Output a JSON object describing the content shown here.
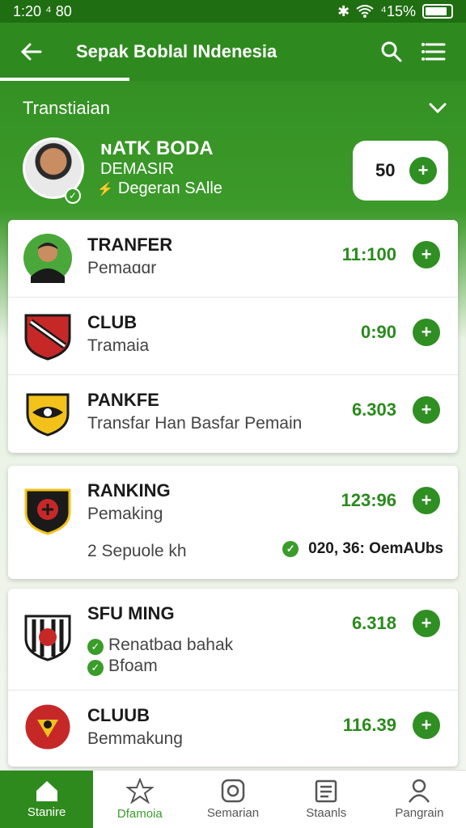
{
  "status_bar": {
    "time": "1:20 ⁴ 80",
    "battery": "⁴15%"
  },
  "app_bar": {
    "title": "Sepak Boblal INdenesia"
  },
  "section": {
    "title": "Transtiaian"
  },
  "hero": {
    "name": "ɴATK BODA",
    "sub": "DEMASIR",
    "note": "Degeran SAlle",
    "pill_value": "50"
  },
  "rows": [
    {
      "name": "TRANFER",
      "sub": "Pemaɑɑr",
      "value": "11:100"
    },
    {
      "name": "CLUB",
      "sub": "Tramaia",
      "value": "0:90"
    },
    {
      "name": "PANKFE",
      "sub": "Transfar Han Basfar Pemain",
      "value": "6.303"
    },
    {
      "name": "RANKING",
      "sub": "Pemaking",
      "value": "123:96",
      "extra": "2  Sepuole kh",
      "footer": "020, 36: OemAUbs"
    },
    {
      "name": "SFU MING",
      "sub": "Renatbaɑ bahak",
      "extra": "Bfoam",
      "value": "6.318"
    },
    {
      "name": "CLUUB",
      "sub": "Bemmakung",
      "value": "116.39"
    }
  ],
  "nav": [
    {
      "label": "Stanire",
      "icon": "home-icon"
    },
    {
      "label": "Dfamoia",
      "icon": "star-icon"
    },
    {
      "label": "Semarian",
      "icon": "instagram-icon"
    },
    {
      "label": "Staanls",
      "icon": "list-icon"
    },
    {
      "label": "Pangrain",
      "icon": "profile-icon"
    }
  ],
  "colors": {
    "brand_green": "#2e8a1e",
    "accent_green": "#2f8f22"
  }
}
